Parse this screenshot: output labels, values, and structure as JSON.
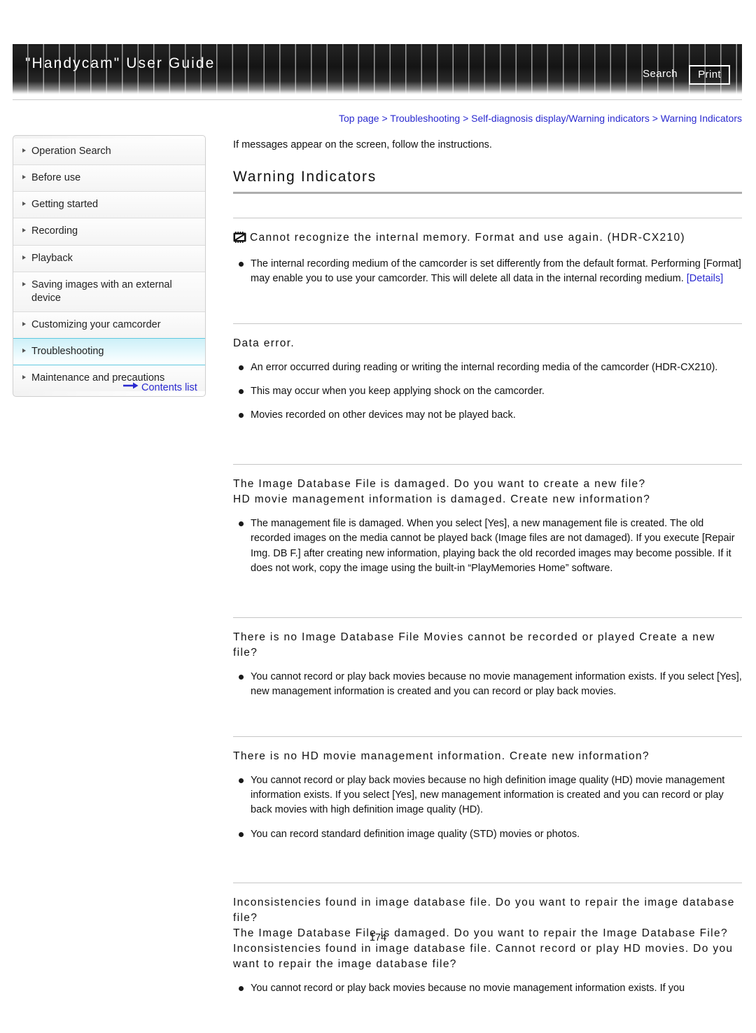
{
  "header": {
    "title": "\"Handycam\" User Guide",
    "search_label": "Search",
    "print_label": "Print"
  },
  "sidebar": {
    "items": [
      {
        "label": "Operation Search",
        "selected": false
      },
      {
        "label": "Before use",
        "selected": false
      },
      {
        "label": "Getting started",
        "selected": false
      },
      {
        "label": "Recording",
        "selected": false
      },
      {
        "label": "Playback",
        "selected": false
      },
      {
        "label": "Saving images with an external device",
        "selected": false
      },
      {
        "label": "Customizing your camcorder",
        "selected": false
      },
      {
        "label": "Troubleshooting",
        "selected": true
      },
      {
        "label": "Maintenance and precautions",
        "selected": false
      }
    ],
    "contents_list_label": "Contents list",
    "contents_list_icon": "arrow-right-icon",
    "selected_accent": "#5fc8e0"
  },
  "main": {
    "breadcrumb": "Top page > Troubleshooting > Self-diagnosis display/Warning indicators > Warning Indicators",
    "intro": "If messages appear on the screen, follow the instructions.",
    "heading": "Warning Indicators",
    "sections": [
      {
        "icon": "memory-card-disabled-icon",
        "title": "Cannot recognize the internal memory. Format and use again. (HDR-CX210)",
        "bullets": [
          {
            "text": "The internal recording medium of the camcorder is set differently from the default format. Performing [Format] may enable you to use your camcorder. This will delete all data in the internal recording medium. ",
            "link": "[Details]"
          }
        ]
      },
      {
        "icon": null,
        "title": "Data error.",
        "bullets": [
          {
            "text": "An error occurred during reading or writing the internal recording media of the camcorder (HDR-CX210).",
            "link": null
          },
          {
            "text": "This may occur when you keep applying shock on the camcorder.",
            "link": null
          },
          {
            "text": "Movies recorded on other devices may not be played back.",
            "link": null
          }
        ]
      },
      {
        "icon": null,
        "title": "The Image Database File is damaged. Do you want to create a new file?\nHD movie management information is damaged. Create new information?",
        "bullets": [
          {
            "text": "The management file is damaged. When you select [Yes], a new management file is created. The old recorded images on the media cannot be played back (Image files are not damaged). If you execute [Repair Img. DB F.] after creating new information, playing back the old recorded images may become possible. If it does not work, copy the image using the built-in “PlayMemories Home” software.",
            "link": null
          }
        ]
      },
      {
        "icon": null,
        "title": "There is no Image Database File Movies cannot be recorded or played Create a new file?",
        "bullets": [
          {
            "text": "You cannot record or play back movies because no movie management information exists. If you select [Yes], new management information is created and you can record or play back movies.",
            "link": null
          }
        ]
      },
      {
        "icon": null,
        "title": "There is no HD movie management information. Create new information?",
        "bullets": [
          {
            "text": "You cannot record or play back movies because no high definition image quality (HD) movie management information exists. If you select [Yes], new management information is created and you can record or play back movies with high definition image quality (HD).",
            "link": null
          },
          {
            "text": "You can record standard definition image quality (STD) movies or photos.",
            "link": null
          }
        ]
      },
      {
        "icon": null,
        "title": "Inconsistencies found in image database file. Do you want to repair the image database file?\nThe Image Database File is damaged. Do you want to repair the Image Database File?\nInconsistencies found in image database file. Cannot record or play HD movies. Do you want to repair the image database file?",
        "bullets": [
          {
            "text": "You cannot record or play back movies because no movie management information exists. If you",
            "link": null
          }
        ]
      }
    ]
  },
  "footer": {
    "page_number": "174"
  }
}
